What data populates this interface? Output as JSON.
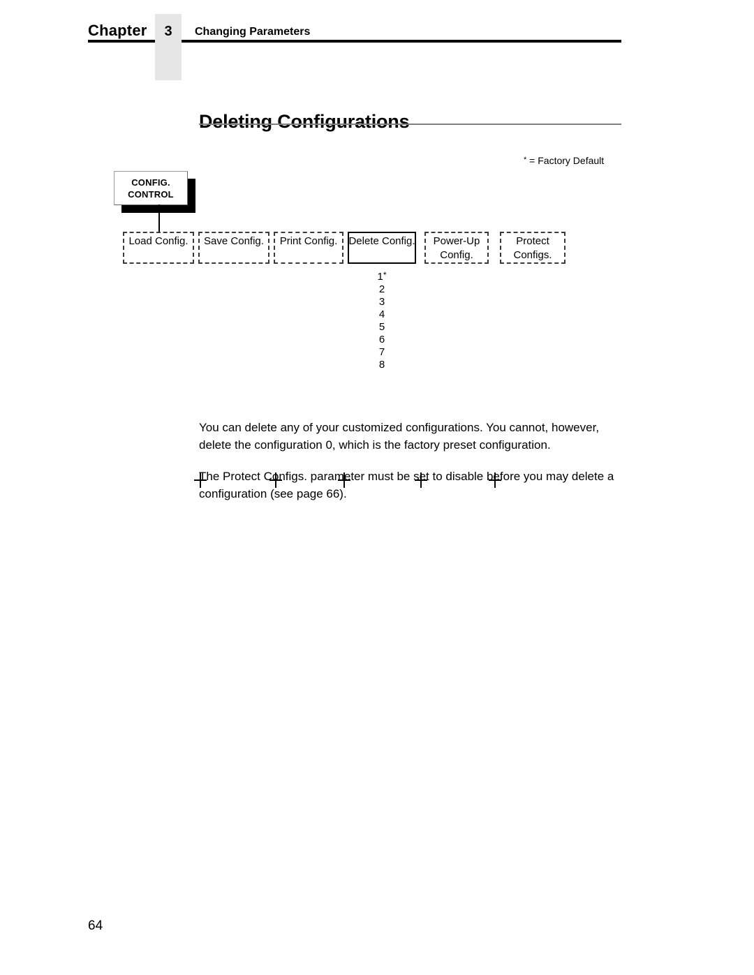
{
  "header": {
    "chapter_word": "Chapter",
    "chapter_number": "3",
    "section_title": "Changing Parameters"
  },
  "heading": "Deleting Configurations",
  "figure": {
    "factory_default_note": "= Factory Default",
    "factory_default_marker": "*",
    "root_box": {
      "line1": "CONFIG.",
      "line2": "CONTROL"
    },
    "menu_items": [
      {
        "line1": "Load Config.",
        "line2": "",
        "selected": false
      },
      {
        "line1": "Save Config.",
        "line2": "",
        "selected": false
      },
      {
        "line1": "Print Config.",
        "line2": "",
        "selected": false
      },
      {
        "line1": "Delete Config.",
        "line2": "",
        "selected": true
      },
      {
        "line1": "Power-Up",
        "line2": "Config.",
        "selected": false
      },
      {
        "line1": "Protect",
        "line2": "Configs.",
        "selected": false
      }
    ],
    "options": [
      {
        "value": "1",
        "marker": "*"
      },
      {
        "value": "2",
        "marker": ""
      },
      {
        "value": "3",
        "marker": ""
      },
      {
        "value": "4",
        "marker": ""
      },
      {
        "value": "5",
        "marker": ""
      },
      {
        "value": "6",
        "marker": ""
      },
      {
        "value": "7",
        "marker": ""
      },
      {
        "value": "8",
        "marker": ""
      }
    ]
  },
  "body": {
    "paragraph1": "You can delete any of your customized configurations. You cannot, however, delete the configuration 0, which is the factory preset configuration.",
    "paragraph2": "The Protect Configs. parameter must be set to disable before you may delete a configuration (see page 66)."
  },
  "folio": "64"
}
